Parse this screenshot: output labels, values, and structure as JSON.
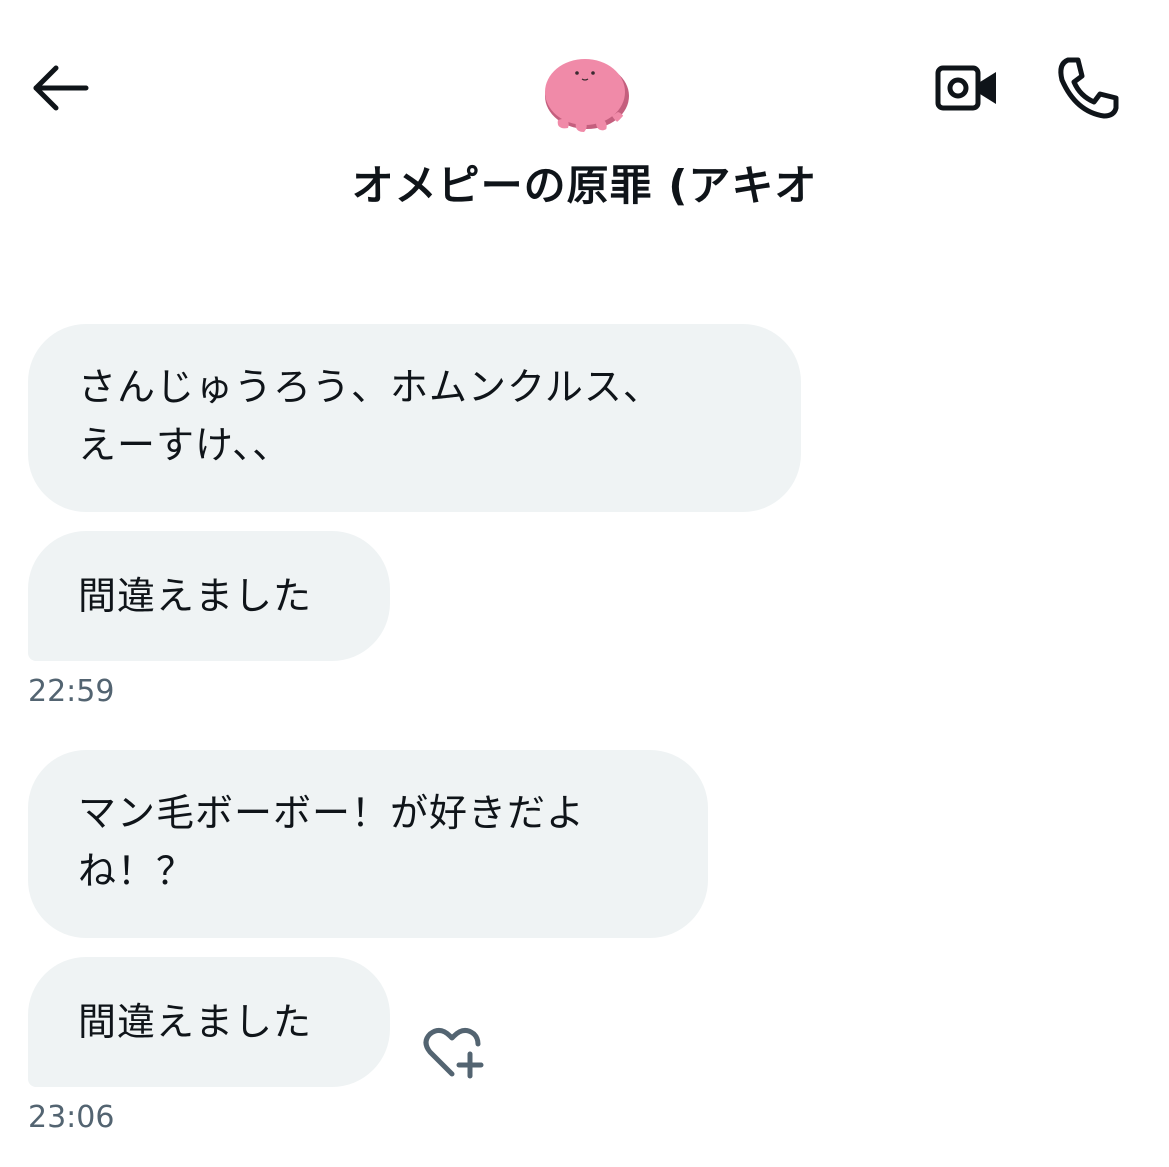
{
  "header": {
    "contact_name": "オメピーの原罪 (アキオ",
    "back_icon": "arrow-left-icon",
    "video_icon": "video-camera-icon",
    "call_icon": "phone-icon",
    "avatar_color": "#f08aa8"
  },
  "messages": [
    {
      "lines": [
        "さんじゅうろう、ホムンクルス、",
        "えーすけ、、"
      ]
    },
    {
      "lines": [
        "間違えました"
      ],
      "timestamp": "22:59"
    },
    {
      "lines": [
        "マン毛ボーボー！が好きだよ",
        "ね！？"
      ]
    },
    {
      "lines": [
        "間違えました"
      ],
      "timestamp": "23:06",
      "reaction_icon": "heart-plus-icon"
    }
  ],
  "colors": {
    "bubble_bg": "#eff3f4",
    "timestamp": "#536471",
    "text": "#0f1419"
  }
}
